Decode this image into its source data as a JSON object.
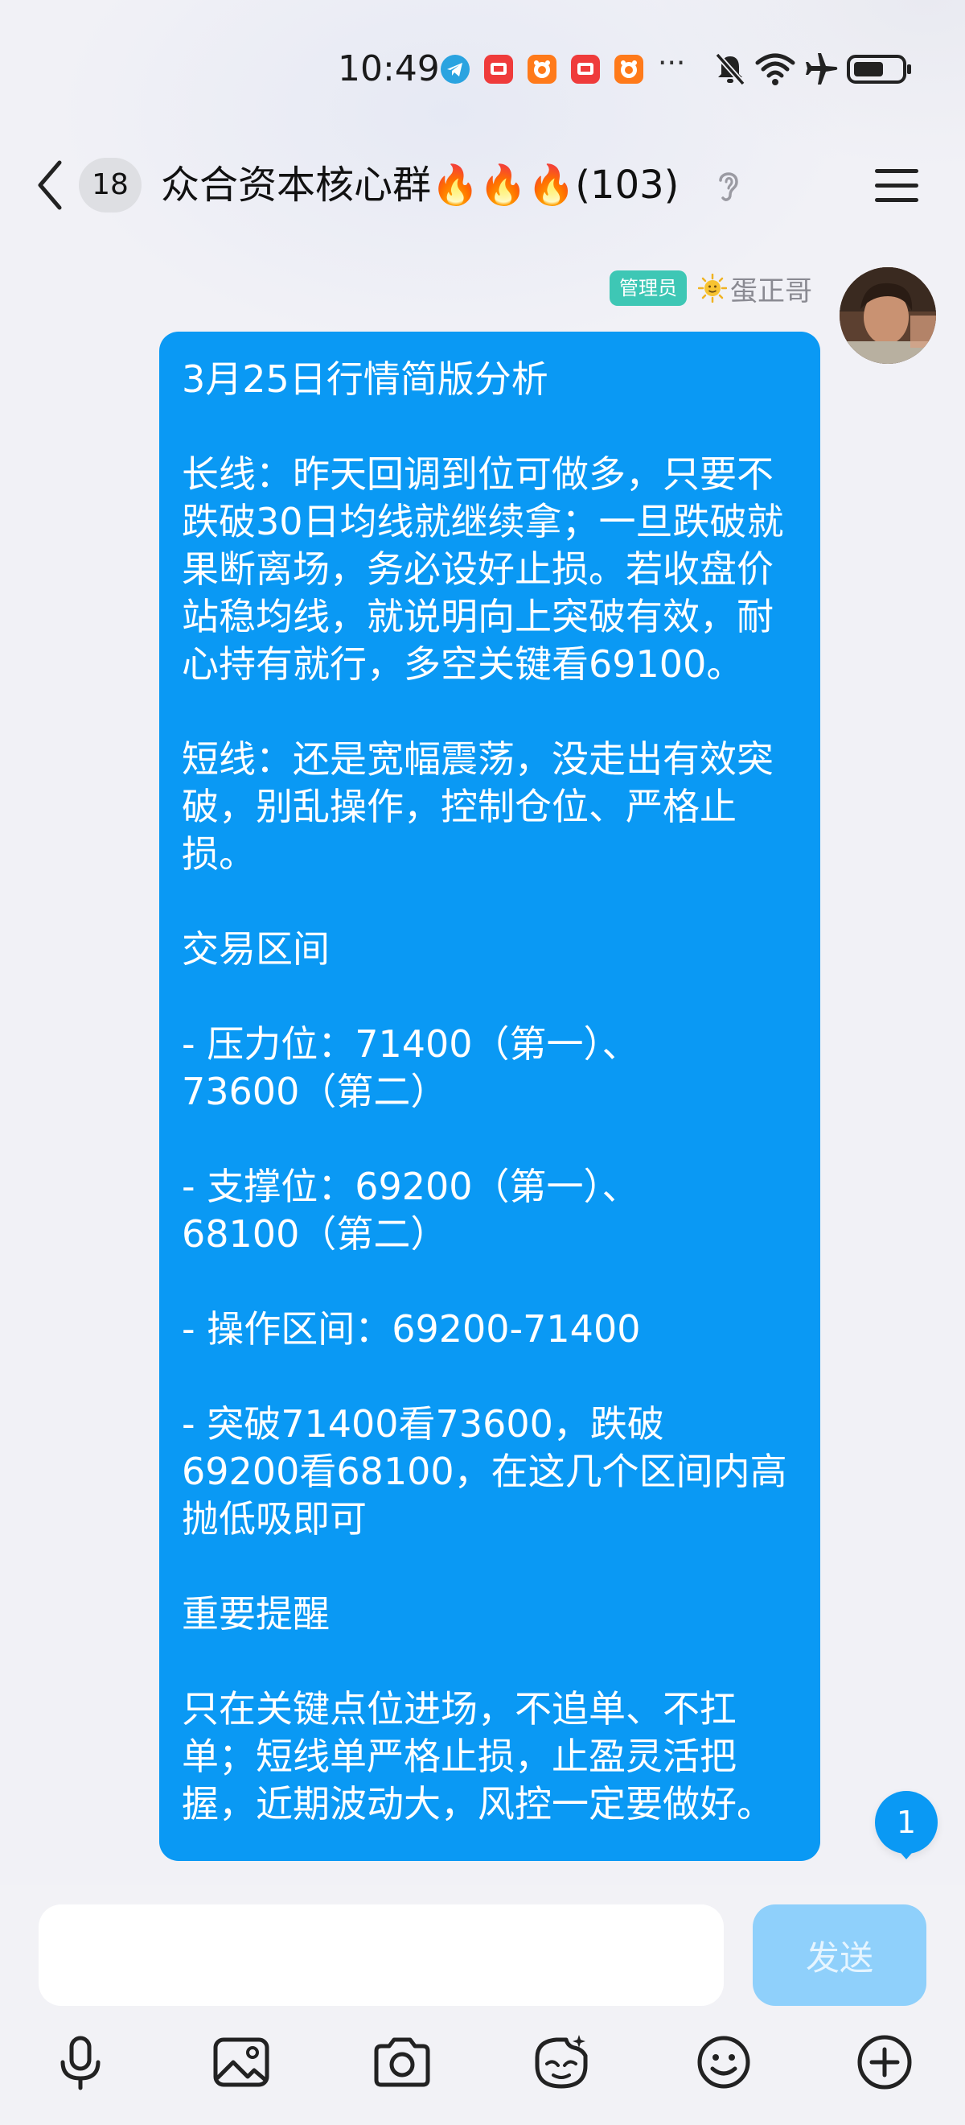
{
  "status_bar": {
    "time": "10:49",
    "more": "···",
    "icons": [
      "telegram-icon",
      "red-app-icon",
      "orange-app-icon",
      "red-app-icon",
      "orange-app-icon",
      "mute-icon",
      "wifi-icon",
      "airplane-icon",
      "battery-icon"
    ]
  },
  "header": {
    "unread_count": "18",
    "title": "众合资本核心群🔥🔥🔥(103)",
    "icons": [
      "back-icon",
      "ear-icon",
      "menu-icon"
    ]
  },
  "message": {
    "role_badge": "管理员",
    "sender_name": "蛋正哥",
    "text": "3月25日行情简版分析\n\n长线：昨天回调到位可做多，只要不跌破30日均线就继续拿；一旦跌破就果断离场，务必设好止损。若收盘价站稳均线，就说明向上突破有效，耐心持有就行，多空关键看69100。\n\n短线：还是宽幅震荡，没走出有效突破，别乱操作，控制仓位、严格止损。\n\n交易区间\n\n- 压力位：71400（第一）、\n73600（第二）\n\n- 支撑位：69200（第一）、\n68100（第二）\n\n- 操作区间：69200-71400\n\n- 突破71400看73600，跌破\n69200看68100，在这几个区间内高抛低吸即可\n\n重要提醒\n\n只在关键点位进场，不追单、不扛单；短线单严格止损，止盈灵活把握，近期波动大，风控一定要做好。"
  },
  "new_message_badge": "1",
  "input_bar": {
    "input_value": "",
    "send_label": "发送",
    "toolbar_icons": [
      "microphone-icon",
      "image-icon",
      "camera-icon",
      "sticker-icon",
      "emoji-icon",
      "plus-icon"
    ]
  },
  "colors": {
    "bubble": "#0a99f4",
    "badge": "#3ec7b5",
    "send_disabled": "#8fd0fb"
  }
}
